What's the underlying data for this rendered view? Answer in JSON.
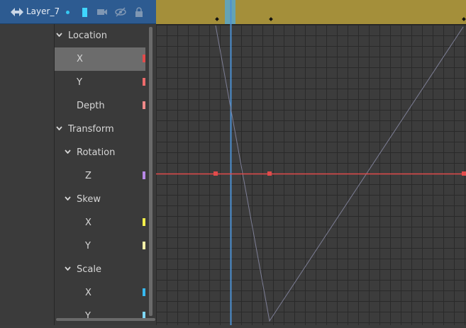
{
  "layer": {
    "name": "Layer_7",
    "layer_color": "#3fd6ff",
    "icons": [
      "motion-tween-icon",
      "camera-icon",
      "visibility-hidden-icon",
      "lock-icon"
    ]
  },
  "properties": [
    {
      "label": "Location",
      "level": 0,
      "expandable": true
    },
    {
      "label": "X",
      "level": 1,
      "selected": true,
      "color": "#e24b4b"
    },
    {
      "label": "Y",
      "level": 1,
      "color": "#ee6b6b"
    },
    {
      "label": "Depth",
      "level": 1,
      "color": "#f08a8a"
    },
    {
      "label": "Transform",
      "level": 0,
      "expandable": true
    },
    {
      "label": "Rotation",
      "level": 1,
      "expandable": true
    },
    {
      "label": "Z",
      "level": 2,
      "color": "#b889e6"
    },
    {
      "label": "Skew",
      "level": 1,
      "expandable": true
    },
    {
      "label": "X",
      "level": 2,
      "color": "#f4f04a"
    },
    {
      "label": "Y",
      "level": 2,
      "color": "#f4f0a8"
    },
    {
      "label": "Scale",
      "level": 1,
      "expandable": true
    },
    {
      "label": "X",
      "level": 2,
      "color": "#37b9f0"
    },
    {
      "label": "Y",
      "level": 2,
      "color": "#7fd8f8"
    }
  ],
  "graph": {
    "span_bar_color": "#a48f3a",
    "playhead_color": "#4c8fd0",
    "curve_color": "#e24b4b",
    "grid": true
  }
}
